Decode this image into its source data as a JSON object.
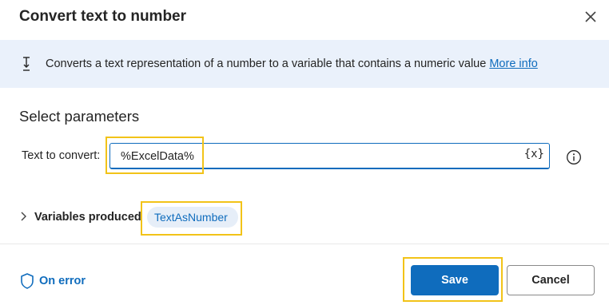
{
  "dialog": {
    "title": "Convert text to number",
    "close_icon": "close-icon"
  },
  "info": {
    "icon": "convert-icon",
    "description": "Converts a text representation of a number to a variable that contains a numeric value ",
    "link_text": "More info"
  },
  "parameters": {
    "section_title": "Select parameters",
    "text_to_convert": {
      "label": "Text to convert:",
      "value": "%ExcelData%",
      "variable_button": "{x}",
      "help_icon": "info-circle-icon"
    }
  },
  "variables": {
    "label": "Variables produced",
    "items": [
      "TextAsNumber"
    ]
  },
  "footer": {
    "on_error_label": "On error",
    "save_label": "Save",
    "cancel_label": "Cancel"
  },
  "colors": {
    "accent": "#0f6cbd",
    "info_bg": "#eaf1fb",
    "highlight": "#f2c318"
  }
}
